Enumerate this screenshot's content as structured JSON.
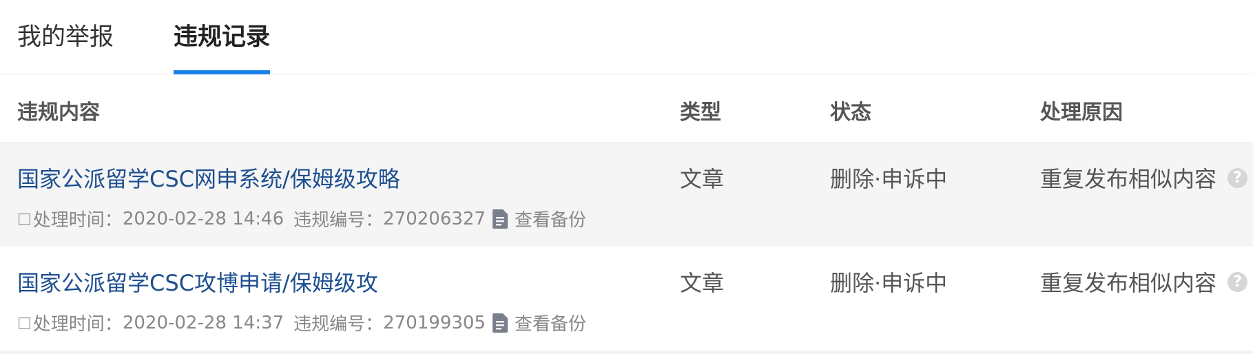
{
  "tabs": [
    {
      "label": "我的举报",
      "active": false
    },
    {
      "label": "违规记录",
      "active": true
    }
  ],
  "accent_color": "#1a7fe8",
  "table": {
    "headers": {
      "content": "违规内容",
      "type": "类型",
      "status": "状态",
      "reason": "处理原因"
    },
    "rows": [
      {
        "title": "国家公派留学CSC网申系统/保姆级攻略",
        "meta_box": "□",
        "time_label": "处理时间：",
        "time": "2020-02-28 14:46",
        "id_label": "违规编号：",
        "id": "270206327",
        "backup_label": "查看备份",
        "type": "文章",
        "status": "删除·申诉中",
        "reason": "重复发布相似内容",
        "help": "?"
      },
      {
        "title": "国家公派留学CSC攻博申请/保姆级攻",
        "meta_box": "□",
        "time_label": "处理时间：",
        "time": "2020-02-28 14:37",
        "id_label": "违规编号：",
        "id": "270199305",
        "backup_label": "查看备份",
        "type": "文章",
        "status": "删除·申诉中",
        "reason": "重复发布相似内容",
        "help": "?"
      }
    ]
  }
}
